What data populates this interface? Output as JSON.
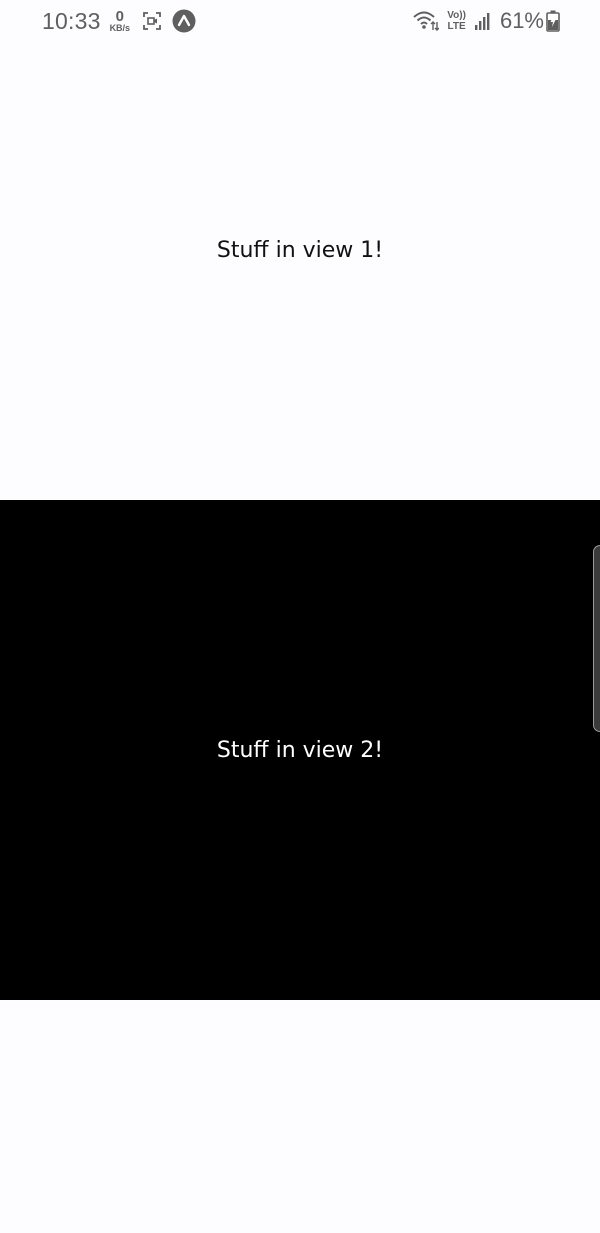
{
  "status_bar": {
    "time": "10:33",
    "net_speed_value": "0",
    "net_speed_unit": "KB/s",
    "volte_top": "Vo))",
    "volte_bottom": "LTE",
    "battery_percent": "61%",
    "icons": [
      "screen-recorder-icon",
      "expo-icon",
      "wifi-icon",
      "volte-icon",
      "signal-icon",
      "battery-charging-icon"
    ]
  },
  "views": [
    {
      "text": "Stuff in view 1!",
      "background": "#fdfcfe",
      "text_color": "#111111"
    },
    {
      "text": "Stuff in view 2!",
      "background": "#000000",
      "text_color": "#ffffff"
    }
  ]
}
